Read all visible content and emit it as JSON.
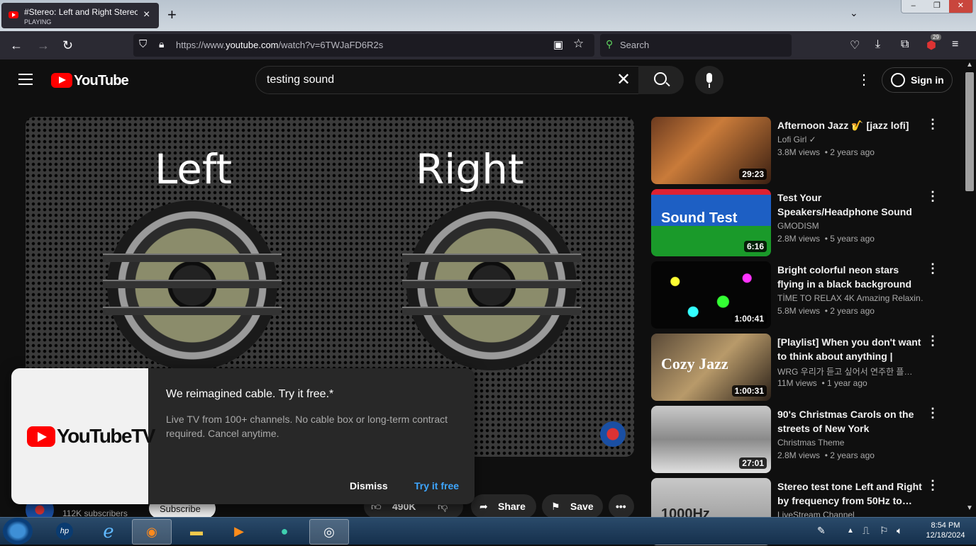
{
  "browser": {
    "tab": {
      "title": "#Stereo: Left and Right Stereo Sound Test",
      "status": "PLAYING"
    },
    "url_prefix": "https://www.",
    "url_host": "youtube.com",
    "url_path": "/watch?v=6TWJaFD6R2s",
    "search_placeholder": "Search",
    "extension_badge": "29"
  },
  "youtube": {
    "logo_text": "YouTube",
    "search_query": "testing sound",
    "sign_in_label": "Sign in"
  },
  "video": {
    "left_label": "Left",
    "right_label": "Right"
  },
  "below_video": {
    "subscribers": "112K subscribers",
    "subscribe_label": "Subscribe",
    "like_count": "490K",
    "share_label": "Share",
    "save_label": "Save"
  },
  "popup": {
    "brand": "YouTubeTV",
    "title": "We reimagined cable. Try it free.*",
    "description": "Live TV from 100+ channels. No cable box or long-term contract required. Cancel anytime.",
    "dismiss_label": "Dismiss",
    "try_label": "Try it free"
  },
  "recommendations": [
    {
      "title": "Afternoon Jazz 🎷 [jazz lofi]",
      "channel": "Lofi Girl ✓",
      "views": "3.8M views",
      "age": "2 years ago",
      "duration": "29:23",
      "thumb_text": ""
    },
    {
      "title": "Test Your Speakers/Headphone Sound Test: Low/Mid/High, L/…",
      "channel": "GMODISM",
      "views": "2.8M views",
      "age": "5 years ago",
      "duration": "6:16",
      "thumb_text": "Sound Test"
    },
    {
      "title": "Bright colorful neon stars flying in a black background",
      "channel": "TİME TO RELAX 4K Amazing Relaxin…",
      "views": "5.8M views",
      "age": "2 years ago",
      "duration": "1:00:41",
      "thumb_text": ""
    },
    {
      "title": "[Playlist] When you don't want to think about anything | Cozy…",
      "channel": "WRG 우리가 듣고 싶어서 연주한 플…",
      "views": "11M views",
      "age": "1 year ago",
      "duration": "1:00:31",
      "thumb_text": "Cozy Jazz"
    },
    {
      "title": "90's Christmas Carols on the streets of New York",
      "channel": "Christmas Theme",
      "views": "2.8M views",
      "age": "2 years ago",
      "duration": "27:01",
      "thumb_text": ""
    },
    {
      "title": "Stereo test tone Left and Right by frequency from 50Hz to…",
      "channel": "LiveStream Channel",
      "views": "",
      "age": "",
      "duration": "",
      "thumb_text": "1000Hz"
    }
  ],
  "taskbar": {
    "time": "8:54 PM",
    "date": "12/18/2024"
  }
}
